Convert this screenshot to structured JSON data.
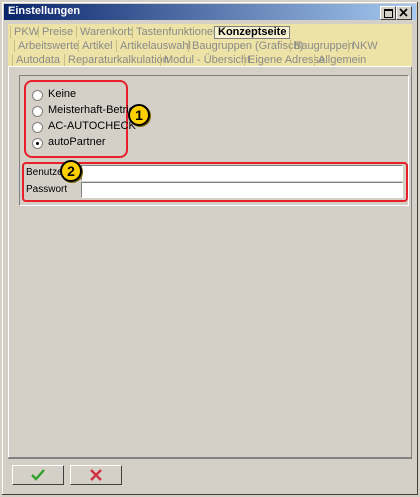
{
  "window": {
    "title": "Einstellungen"
  },
  "tabs": {
    "row1": [
      "PKW",
      "Preise",
      "Warenkorb",
      "Tastenfunktionen",
      "Konzeptseite"
    ],
    "row2": [
      "Arbeitswerte",
      "Artikel",
      "Artikelauswahl",
      "Baugruppen (Grafisch)",
      "Baugruppen",
      "NKW"
    ],
    "row3": [
      "Autodata",
      "Reparaturkalkulation",
      "Modul - Übersicht",
      "Eigene Adresse",
      "Allgemein"
    ],
    "active": "Konzeptseite"
  },
  "options": {
    "items": [
      "Keine",
      "Meisterhaft-Betrieb",
      "AC-AUTOCHECK",
      "autoPartner"
    ],
    "selected": "autoPartner"
  },
  "credentials": {
    "user_label": "Benutzer",
    "user_value": "",
    "password_label": "Passwort",
    "password_value": ""
  },
  "annotations": {
    "badge1": "1",
    "badge2": "2"
  },
  "colors": {
    "highlight": "#e8202a",
    "badge": "#ffd000",
    "tab_bg": "#ede3a6",
    "title_start": "#0a246a"
  },
  "icons": {
    "ok": "checkmark-icon",
    "cancel": "cross-icon"
  }
}
